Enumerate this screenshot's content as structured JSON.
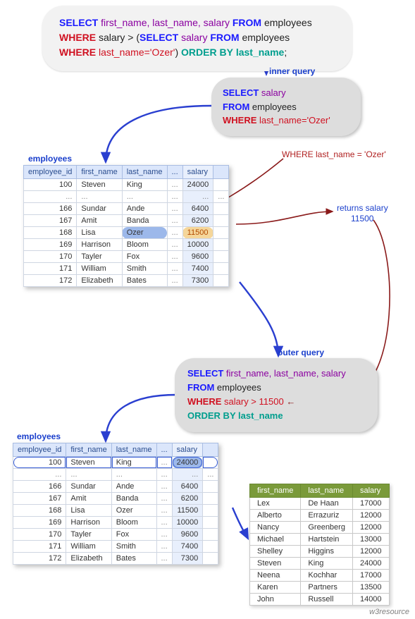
{
  "top_query": {
    "l1_select": "SELECT",
    "l1_cols": "first_name, last_name, salary",
    "l1_from": "FROM",
    "l1_tbl": "employees",
    "l2_where": "WHERE",
    "l2_txt1": "salary > (",
    "l2_select": "SELECT",
    "l2_cols": "salary",
    "l2_from": "FROM",
    "l2_tbl": "employees",
    "l3_where": "WHERE",
    "l3_txt": "last_name='Ozer'",
    "l3_close": ")",
    "l3_orderby": "ORDER BY",
    "l3_col": " last_name",
    "l3_semi": ";"
  },
  "labels": {
    "inner_query": "inner query",
    "outer_query": "outer query",
    "employees1": "employees",
    "employees2": "employees"
  },
  "inner_box": {
    "select": "SELECT",
    "cols": "salary",
    "from": "FROM",
    "tbl": "employees",
    "where": "WHERE",
    "cond": "last_name='Ozer'"
  },
  "outer_box": {
    "select": "SELECT",
    "cols": "first_name, last_name, salary",
    "from": "FROM",
    "tbl": "employees",
    "where": "WHERE",
    "cond": "salary > 11500",
    "orderby": "ORDER BY",
    "ordcol": " last_name"
  },
  "emp_headers": {
    "id": "employee_id",
    "fn": "first_name",
    "ln": "last_name",
    "sal": "salary",
    "dot": "..."
  },
  "emp_rows": [
    {
      "id": "100",
      "fn": "Steven",
      "ln": "King",
      "sal": "24000"
    },
    {
      "dots": true
    },
    {
      "id": "166",
      "fn": "Sundar",
      "ln": "Ande",
      "sal": "6400"
    },
    {
      "id": "167",
      "fn": "Amit",
      "ln": "Banda",
      "sal": "6200"
    },
    {
      "id": "168",
      "fn": "Lisa",
      "ln": "Ozer",
      "sal": "11500"
    },
    {
      "id": "169",
      "fn": "Harrison",
      "ln": "Bloom",
      "sal": "10000"
    },
    {
      "id": "170",
      "fn": "Tayler",
      "ln": "Fox",
      "sal": "9600"
    },
    {
      "id": "171",
      "fn": "William",
      "ln": "Smith",
      "sal": "7400"
    },
    {
      "id": "172",
      "fn": "Elizabeth",
      "ln": "Bates",
      "sal": "7300"
    }
  ],
  "notes": {
    "where_ozer": "WHERE last_name = 'Ozer'",
    "returns_salary": "returns salary",
    "returns_value": "11500"
  },
  "result_headers": {
    "fn": "first_name",
    "ln": "last_name",
    "sal": "salary"
  },
  "result_rows": [
    {
      "fn": "Lex",
      "ln": "De Haan",
      "sal": "17000"
    },
    {
      "fn": "Alberto",
      "ln": "Errazuriz",
      "sal": "12000"
    },
    {
      "fn": "Nancy",
      "ln": "Greenberg",
      "sal": "12000"
    },
    {
      "fn": "Michael",
      "ln": "Hartstein",
      "sal": "13000"
    },
    {
      "fn": "Shelley",
      "ln": "Higgins",
      "sal": "12000"
    },
    {
      "fn": "Steven",
      "ln": "King",
      "sal": "24000"
    },
    {
      "fn": "Neena",
      "ln": "Kochhar",
      "sal": "17000"
    },
    {
      "fn": "Karen",
      "ln": "Partners",
      "sal": "13500"
    },
    {
      "fn": "John",
      "ln": "Russell",
      "sal": "14000"
    }
  ],
  "footer": "w3resource"
}
